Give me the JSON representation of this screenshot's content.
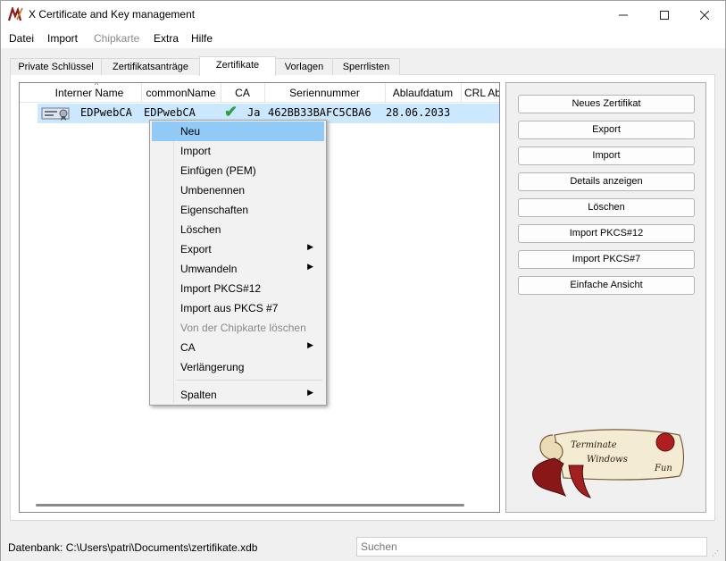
{
  "window": {
    "title": "X Certificate and Key management",
    "controls": {
      "minimize": "—",
      "maximize": "☐",
      "close": "✕"
    }
  },
  "menubar": [
    {
      "label": "Datei",
      "enabled": true
    },
    {
      "label": "Import",
      "enabled": true
    },
    {
      "label": "Chipkarte",
      "enabled": false
    },
    {
      "label": "Extra",
      "enabled": true
    },
    {
      "label": "Hilfe",
      "enabled": true
    }
  ],
  "tabs": [
    {
      "label": "Private Schlüssel"
    },
    {
      "label": "Zertifikatsanträge"
    },
    {
      "label": "Zertifikate",
      "active": true
    },
    {
      "label": "Vorlagen"
    },
    {
      "label": "Sperrlisten"
    }
  ],
  "table": {
    "columns": [
      "Interner Name",
      "commonName",
      "CA",
      "Seriennummer",
      "Ablaufdatum",
      "CRL Ab"
    ],
    "rows": [
      {
        "icon": "certificate-icon",
        "internal_name": "EDPwebCA",
        "common_name": "EDPwebCA",
        "ca_icon": "checkmark-icon",
        "ca": "Ja",
        "serial": "462BB33BAFC5CBA6",
        "expiry": "28.06.2033"
      }
    ]
  },
  "side_buttons": [
    "Neues Zertifikat",
    "Export",
    "Import",
    "Details anzeigen",
    "Löschen",
    "Import PKCS#12",
    "Import PKCS#7",
    "Einfache Ansicht"
  ],
  "logo": {
    "text_line1": "Terminate",
    "text_line2": "Windows",
    "text_line3": "Fun"
  },
  "context_menu": {
    "items": [
      {
        "label": "Neu",
        "highlighted": true
      },
      {
        "label": "Import"
      },
      {
        "label": "Einfügen (PEM)"
      },
      {
        "label": "Umbenennen"
      },
      {
        "label": "Eigenschaften"
      },
      {
        "label": "Löschen"
      },
      {
        "label": "Export",
        "submenu": true
      },
      {
        "label": "Umwandeln",
        "submenu": true
      },
      {
        "label": "Import PKCS#12"
      },
      {
        "label": "Import aus PKCS #7"
      },
      {
        "label": "Von der Chipkarte löschen",
        "disabled": true
      },
      {
        "label": "CA",
        "submenu": true
      },
      {
        "label": "Verlängerung"
      },
      {
        "label": "Spalten",
        "submenu": true
      }
    ],
    "submenu_arrow": "▶"
  },
  "statusbar": {
    "database": "Datenbank: C:\\Users\\patri\\Documents\\zertifikate.xdb",
    "search_placeholder": "Suchen"
  },
  "colors": {
    "selection": "#cce8ff",
    "menu_highlight": "#91c9f7",
    "check": "#2ea043"
  }
}
